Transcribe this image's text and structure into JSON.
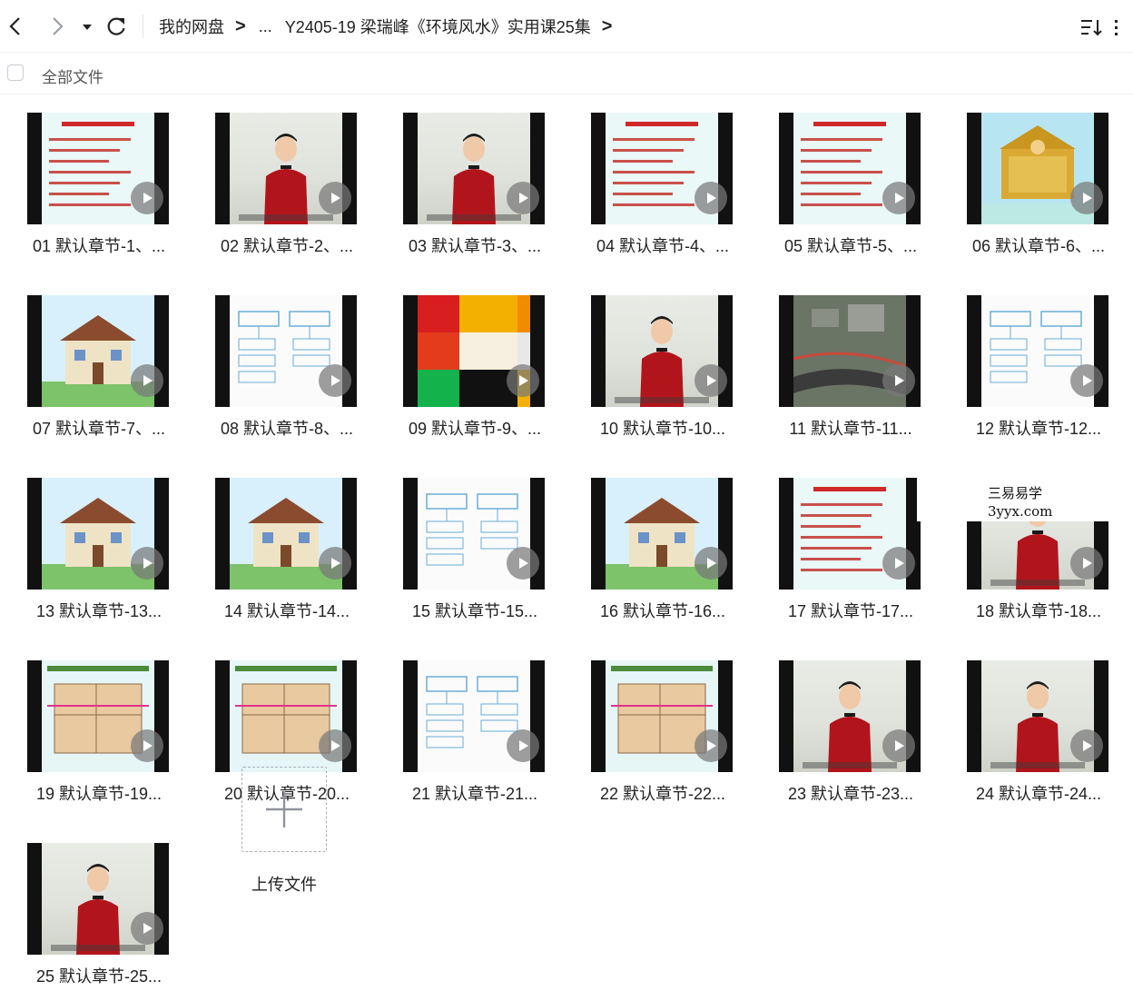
{
  "toolbar": {
    "back_icon": "chevron-left-icon",
    "forward_icon": "chevron-right-icon",
    "dropdown_icon": "caret-down-icon",
    "refresh_icon": "refresh-icon",
    "sort_icon": "sort-list-icon",
    "view_icon": "list-view-icon"
  },
  "breadcrumb": {
    "root": "我的网盘",
    "ellipsis": "...",
    "current": "Y2405-19 梁瑞峰《环境风水》实用课25集",
    "separator": ">"
  },
  "selection": {
    "all_files_label": "全部文件"
  },
  "files": [
    {
      "label": "01 默认章节-1、...",
      "thumb": "slide"
    },
    {
      "label": "02 默认章节-2、...",
      "thumb": "video"
    },
    {
      "label": "03 默认章节-3、...",
      "thumb": "video"
    },
    {
      "label": "04 默认章节-4、...",
      "thumb": "slide"
    },
    {
      "label": "05 默认章节-5、...",
      "thumb": "slide"
    },
    {
      "label": "06 默认章节-6、...",
      "thumb": "palace"
    },
    {
      "label": "07 默认章节-7、...",
      "thumb": "house"
    },
    {
      "label": "08 默认章节-8、...",
      "thumb": "board"
    },
    {
      "label": "09 默认章节-9、...",
      "thumb": "color"
    },
    {
      "label": "10 默认章节-10...",
      "thumb": "video"
    },
    {
      "label": "11 默认章节-11...",
      "thumb": "map"
    },
    {
      "label": "12 默认章节-12...",
      "thumb": "board"
    },
    {
      "label": "13 默认章节-13...",
      "thumb": "house"
    },
    {
      "label": "14 默认章节-14...",
      "thumb": "house"
    },
    {
      "label": "15 默认章节-15...",
      "thumb": "board"
    },
    {
      "label": "16 默认章节-16...",
      "thumb": "house"
    },
    {
      "label": "17 默认章节-17...",
      "thumb": "slide"
    },
    {
      "label": "18 默认章节-18...",
      "thumb": "video"
    },
    {
      "label": "19 默认章节-19...",
      "thumb": "floor"
    },
    {
      "label": "20 默认章节-20...",
      "thumb": "floor"
    },
    {
      "label": "21 默认章节-21...",
      "thumb": "board"
    },
    {
      "label": "22 默认章节-22...",
      "thumb": "floor"
    },
    {
      "label": "23 默认章节-23...",
      "thumb": "video"
    },
    {
      "label": "24 默认章节-24...",
      "thumb": "video"
    },
    {
      "label": "25 默认章节-25...",
      "thumb": "video"
    }
  ],
  "upload": {
    "label": "上传文件",
    "icon": "plus-icon"
  },
  "watermark": {
    "line1": "三易易学",
    "line2": "3yyx.com"
  },
  "colors": {
    "accent_red": "#c3332d",
    "border": "#eceef2",
    "text": "#222222"
  }
}
